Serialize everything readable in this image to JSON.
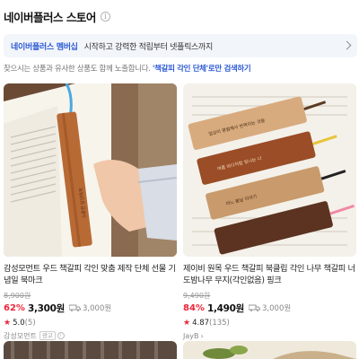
{
  "header": {
    "title": "네이버플러스 스토어",
    "info_icon": "info-icon"
  },
  "banner": {
    "strong": "네이버플러스 멤버십",
    "text": "시작하고 강력한 적립부터 넷플릭스까지",
    "icon": "chevron-right-icon"
  },
  "notice": {
    "before": "찾으시는 상품과 유사한 상품도 함께 노출합니다.",
    "link": "'책갈피 각인 단체'로만 검색하기"
  },
  "products": [
    {
      "title": "감성모먼트 우드 책갈피 각인 맞춤 제작 단체 선물 기념일 북마크",
      "original_price": "8,900원",
      "discount": "62%",
      "price": "3,300원",
      "shipping": "3,000원",
      "rating": "5.0",
      "reviews": "(5)",
      "seller": "감성모먼트",
      "ad_label": "광고",
      "info": "i"
    },
    {
      "title": "제이비 원목 우드 책갈피 북클립 각인 나무 책갈피 너도밤나무 무지(각인없음) 핑크",
      "original_price": "9,490원",
      "discount": "84%",
      "price": "1,490원",
      "shipping": "3,000원",
      "rating": "4.87",
      "reviews": "(135)",
      "seller": "JayB",
      "seller_chevron": "›"
    }
  ],
  "colors": {
    "accent_blue": "#2e5bd6",
    "discount_red": "#f0243a",
    "banner_bg": "#f2f5fa"
  }
}
